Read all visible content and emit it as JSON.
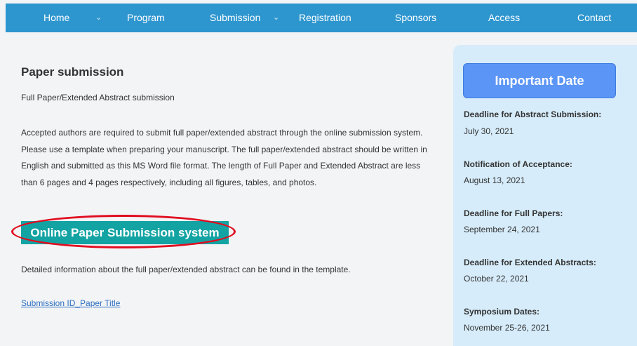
{
  "nav": {
    "items": [
      {
        "label": "Home"
      },
      {
        "label": "Program"
      },
      {
        "label": "Submission"
      },
      {
        "label": "Registration"
      },
      {
        "label": "Sponsors"
      },
      {
        "label": "Access"
      },
      {
        "label": "Contact"
      }
    ],
    "caret_glyph": "⌄"
  },
  "main": {
    "title": "Paper submission",
    "subtitle": "Full Paper/Extended Abstract submission",
    "paragraph": "Accepted authors are required to submit full paper/extended abstract through the online submission system. Please use a template when preparing your manuscript. The full paper/extended abstract should be written in English and submitted as this MS Word file format. The length of Full Paper and Extended Abstract are less than 6 pages and 4 pages respectively, including all figures, tables, and photos.",
    "submit_button": "Online Paper Submission system",
    "detail": "Detailed information about the full paper/extended abstract can be found in the template.",
    "template_link": "Submission ID_Paper Title"
  },
  "sidebar": {
    "title": "Important Date",
    "dates": [
      {
        "label": "Deadline for Abstract Submission:",
        "value": "July 30, 2021"
      },
      {
        "label": "Notification of Acceptance:",
        "value": "August 13, 2021"
      },
      {
        "label": "Deadline for Full Papers:",
        "value": "September 24, 2021"
      },
      {
        "label": "Deadline for Extended Abstracts:",
        "value": "October 22, 2021"
      },
      {
        "label": "Symposium Dates:",
        "value": "November 25-26, 2021"
      }
    ]
  },
  "colors": {
    "nav_bar": "#2e96cf",
    "submit_button": "#13a3a3",
    "highlight_annotation": "#e10c1f",
    "sidebar_bg": "#d6ecfa",
    "sidebar_title_bg": "#5b95f6",
    "link": "#2c6fc2"
  }
}
